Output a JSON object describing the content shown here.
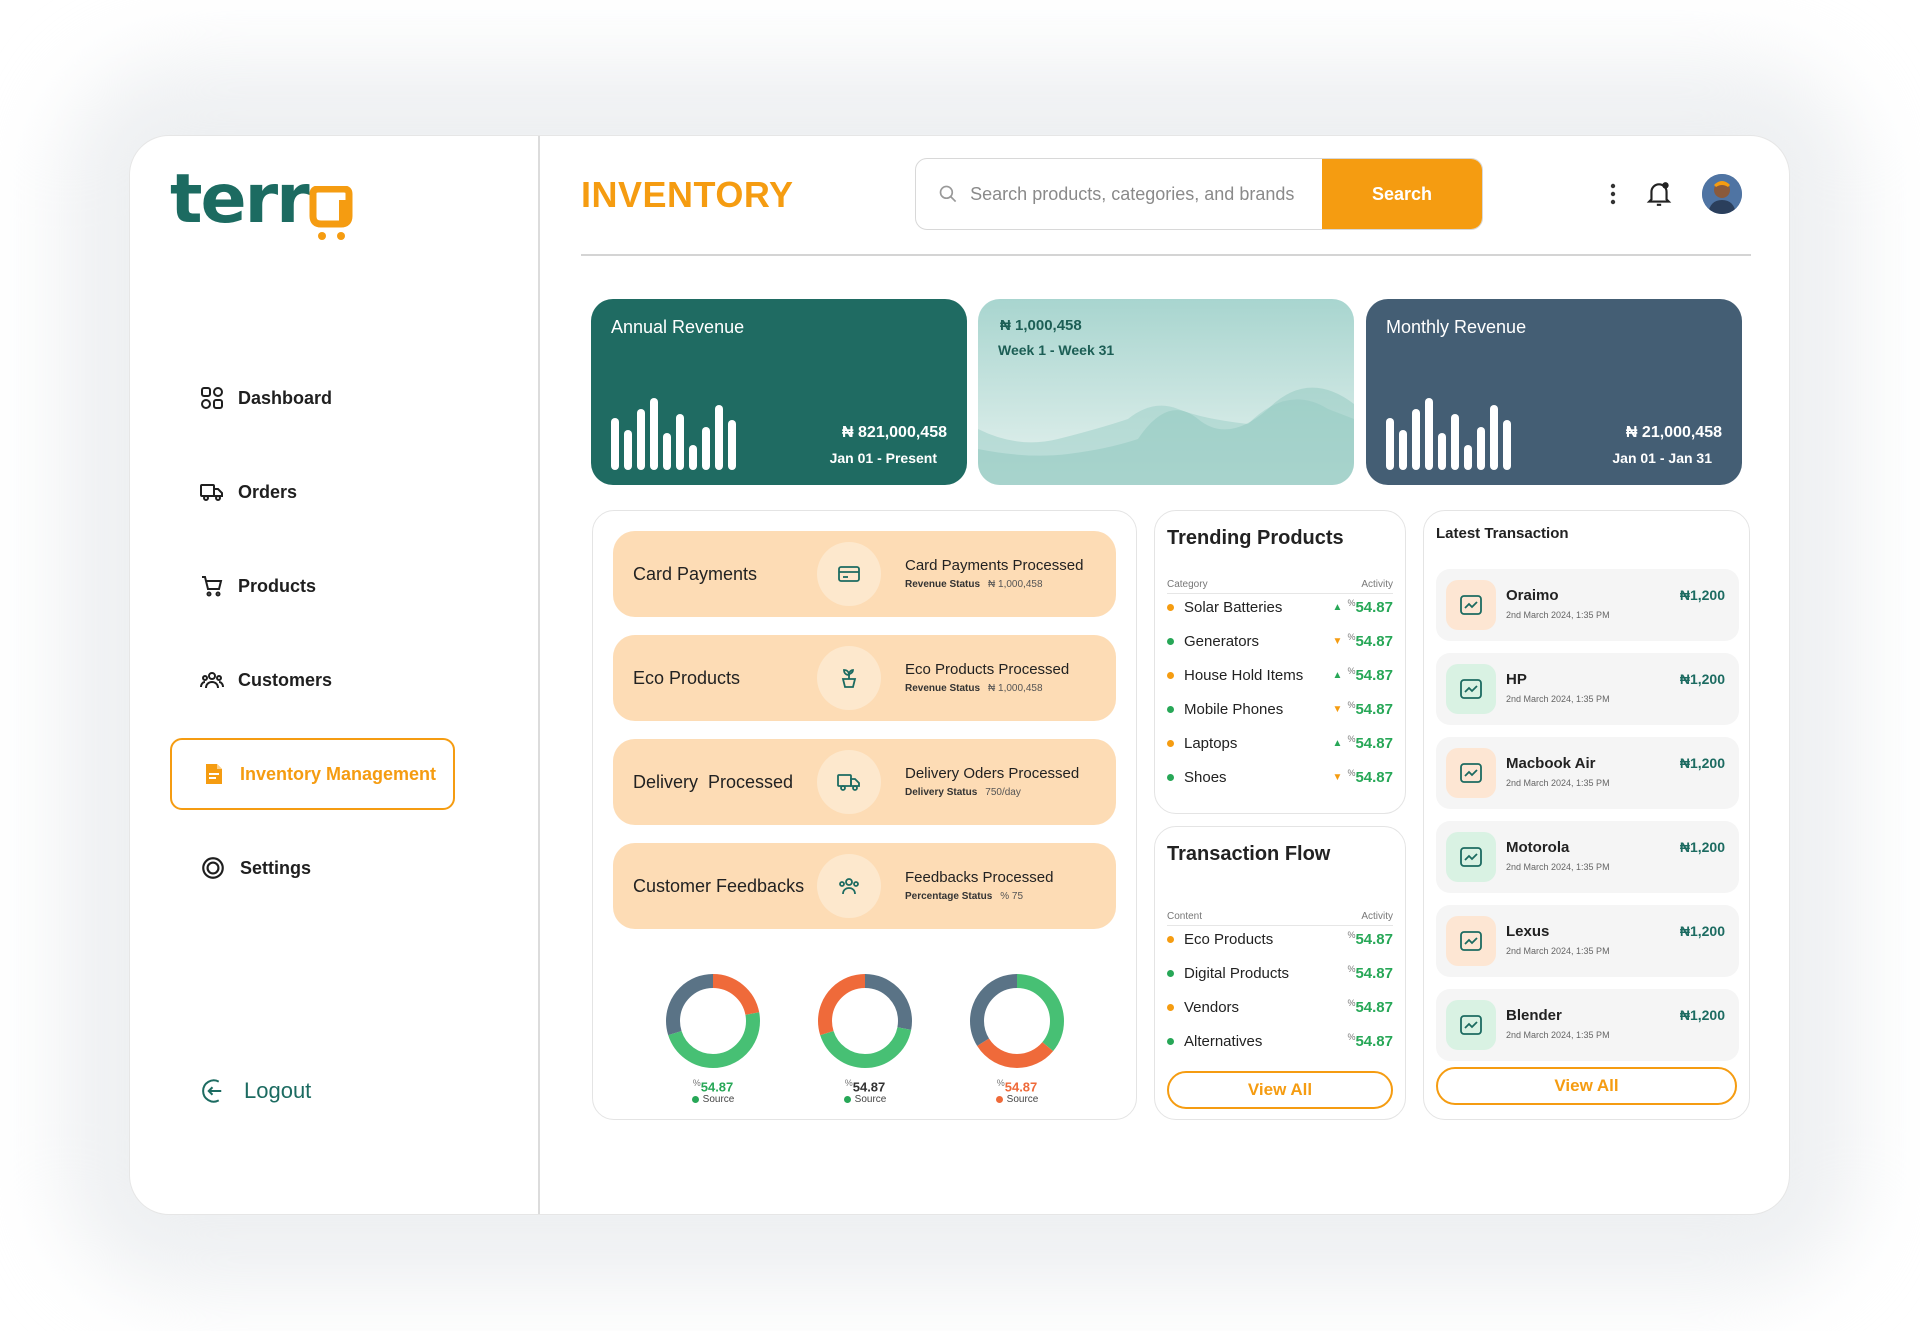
{
  "brand": {
    "logo_text": "terr",
    "logo_tail": "a"
  },
  "sidebar": {
    "items": [
      {
        "label": "Dashboard",
        "icon": "grid-icon"
      },
      {
        "label": "Orders",
        "icon": "truck-icon"
      },
      {
        "label": "Products",
        "icon": "cart-icon"
      },
      {
        "label": "Customers",
        "icon": "people-icon"
      },
      {
        "label": "Inventory Management",
        "icon": "document-icon",
        "active": true
      },
      {
        "label": "Settings",
        "icon": "gear-icon"
      }
    ],
    "logout_label": "Logout"
  },
  "header": {
    "title": "INVENTORY",
    "search_placeholder": "Search products, categories, and brands",
    "search_button": "Search"
  },
  "revenue": {
    "annual": {
      "label": "Annual Revenue",
      "amount": "₦ 821,000,458",
      "range": "Jan 01 - Present",
      "bars": [
        0.72,
        0.55,
        0.85,
        1.0,
        0.52,
        0.78,
        0.35,
        0.6,
        0.9,
        0.7
      ]
    },
    "weekly": {
      "amount": "₦ 1,000,458",
      "range": "Week 1 - Week 31"
    },
    "monthly": {
      "label": "Monthly Revenue",
      "amount": "₦ 21,000,458",
      "range": "Jan 01 - Jan 31",
      "bars": [
        0.72,
        0.55,
        0.85,
        1.0,
        0.52,
        0.78,
        0.35,
        0.6,
        0.9,
        0.7
      ]
    }
  },
  "payments": [
    {
      "title": "Card Payments",
      "icon": "card-icon",
      "processed": "Card Payments Processed",
      "status_label": "Revenue Status",
      "status_value": "₦ 1,000,458"
    },
    {
      "title": "Eco Products",
      "icon": "plant-icon",
      "processed": "Eco Products Processed",
      "status_label": "Revenue Status",
      "status_value": "₦ 1,000,458"
    },
    {
      "title": "Delivery  Processed",
      "icon": "truck-icon",
      "processed": "Delivery Oders Processed",
      "status_label": "Delivery Status",
      "status_value": "750/day"
    },
    {
      "title": "Customer Feedbacks",
      "icon": "people-icon",
      "processed": "Feedbacks Processed",
      "status_label": "Percentage Status",
      "status_value": "% 75"
    }
  ],
  "donuts": [
    {
      "value": "54.87",
      "unit": "%",
      "source": "Source",
      "color": "#27a757",
      "segments": [
        {
          "color": "#ef6a3a",
          "frac": 0.22
        },
        {
          "color": "#47c074",
          "frac": 0.48
        },
        {
          "color": "#5a7386",
          "frac": 0.3
        }
      ]
    },
    {
      "value": "54.87",
      "unit": "%",
      "source": "Source",
      "color": "#27a757",
      "segments": [
        {
          "color": "#5a7386",
          "frac": 0.28
        },
        {
          "color": "#47c074",
          "frac": 0.42
        },
        {
          "color": "#ef6a3a",
          "frac": 0.3
        }
      ]
    },
    {
      "value": "54.87",
      "unit": "%",
      "source": "Source",
      "color": "#ef6a3a",
      "segments": [
        {
          "color": "#47c074",
          "frac": 0.36
        },
        {
          "color": "#ef6a3a",
          "frac": 0.3
        },
        {
          "color": "#5a7386",
          "frac": 0.34
        }
      ]
    }
  ],
  "trending": {
    "title": "Trending Products",
    "col_category": "Category",
    "col_activity": "Activity",
    "items": [
      {
        "name": "Solar Batteries",
        "dot": "#f59c11",
        "trend": "up",
        "unit": "%",
        "value": "54.87"
      },
      {
        "name": "Generators",
        "dot": "#27a757",
        "trend": "down",
        "unit": "%",
        "value": "54.87"
      },
      {
        "name": "House Hold Items",
        "dot": "#f59c11",
        "trend": "up",
        "unit": "%",
        "value": "54.87"
      },
      {
        "name": "Mobile Phones",
        "dot": "#27a757",
        "trend": "down",
        "unit": "%",
        "value": "54.87"
      },
      {
        "name": "Laptops",
        "dot": "#f59c11",
        "trend": "up",
        "unit": "%",
        "value": "54.87"
      },
      {
        "name": "Shoes",
        "dot": "#27a757",
        "trend": "down",
        "unit": "%",
        "value": "54.87"
      }
    ]
  },
  "flow": {
    "title": "Transaction Flow",
    "col_content": "Content",
    "col_activity": "Activity",
    "items": [
      {
        "name": "Eco Products",
        "dot": "#f59c11",
        "unit": "%",
        "value": "54.87"
      },
      {
        "name": "Digital Products",
        "dot": "#27a757",
        "unit": "%",
        "value": "54.87"
      },
      {
        "name": "Vendors",
        "dot": "#f59c11",
        "unit": "%",
        "value": "54.87"
      },
      {
        "name": "Alternatives",
        "dot": "#27a757",
        "unit": "%",
        "value": "54.87"
      }
    ],
    "view_all": "View All"
  },
  "transactions": {
    "title": "Latest Transaction",
    "items": [
      {
        "name": "Oraimo",
        "date": "2nd March 2024, 1:35 PM",
        "amount": "₦1,200",
        "tone": "orange"
      },
      {
        "name": "HP",
        "date": "2nd March 2024, 1:35 PM",
        "amount": "₦1,200",
        "tone": "green"
      },
      {
        "name": "Macbook Air",
        "date": "2nd March 2024, 1:35 PM",
        "amount": "₦1,200",
        "tone": "orange"
      },
      {
        "name": "Motorola",
        "date": "2nd March 2024, 1:35 PM",
        "amount": "₦1,200",
        "tone": "green"
      },
      {
        "name": "Lexus",
        "date": "2nd March 2024, 1:35 PM",
        "amount": "₦1,200",
        "tone": "orange"
      },
      {
        "name": "Blender",
        "date": "2nd March 2024, 1:35 PM",
        "amount": "₦1,200",
        "tone": "green"
      }
    ],
    "view_all": "View All"
  },
  "colors": {
    "brand": "#1c6b61",
    "accent": "#f59c11",
    "peach": "#fddcb5",
    "slate": "#445e74",
    "positive": "#27a757",
    "negative": "#ef6a3a"
  }
}
